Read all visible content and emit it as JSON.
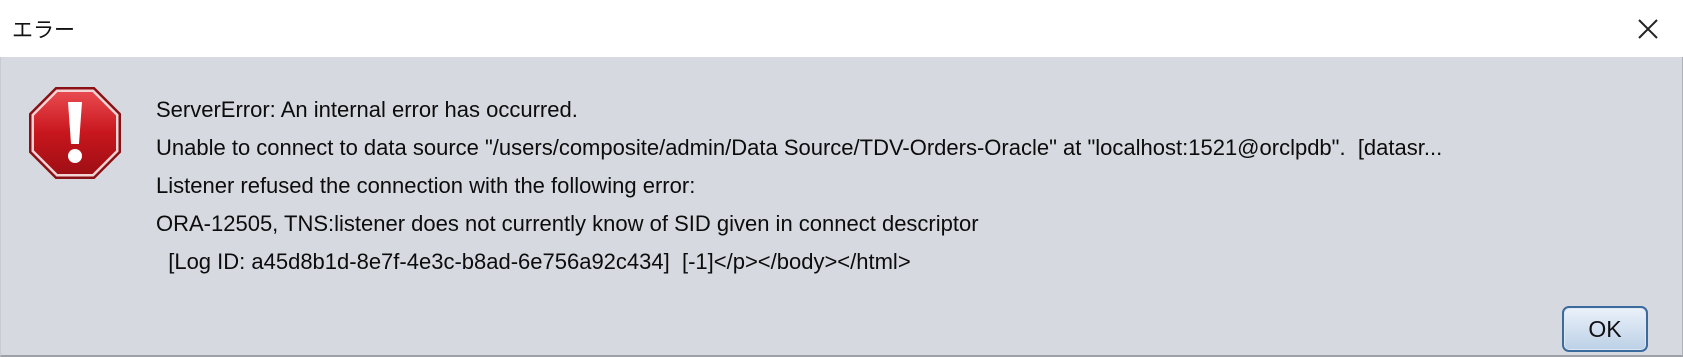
{
  "window": {
    "title": "エラー",
    "close_icon": "close-icon"
  },
  "dialog": {
    "icon": "error-stop-icon",
    "icon_color": "#c8161d",
    "messages": [
      "ServerError: An internal error has occurred.",
      "Unable to connect to data source \"/users/composite/admin/Data Source/TDV-Orders-Oracle\" at \"localhost:1521@orclpdb\".  [datasr...",
      "Listener refused the connection with the following error:",
      "ORA-12505, TNS:listener does not currently know of SID given in connect descriptor",
      "  [Log ID: a45d8b1d-8e7f-4e3c-b8ad-6e756a92c434]  [-1]</p></body></html>"
    ],
    "ok_label": "OK"
  },
  "colors": {
    "body_bg": "#d6d9e0",
    "button_border": "#3b6a9c"
  }
}
